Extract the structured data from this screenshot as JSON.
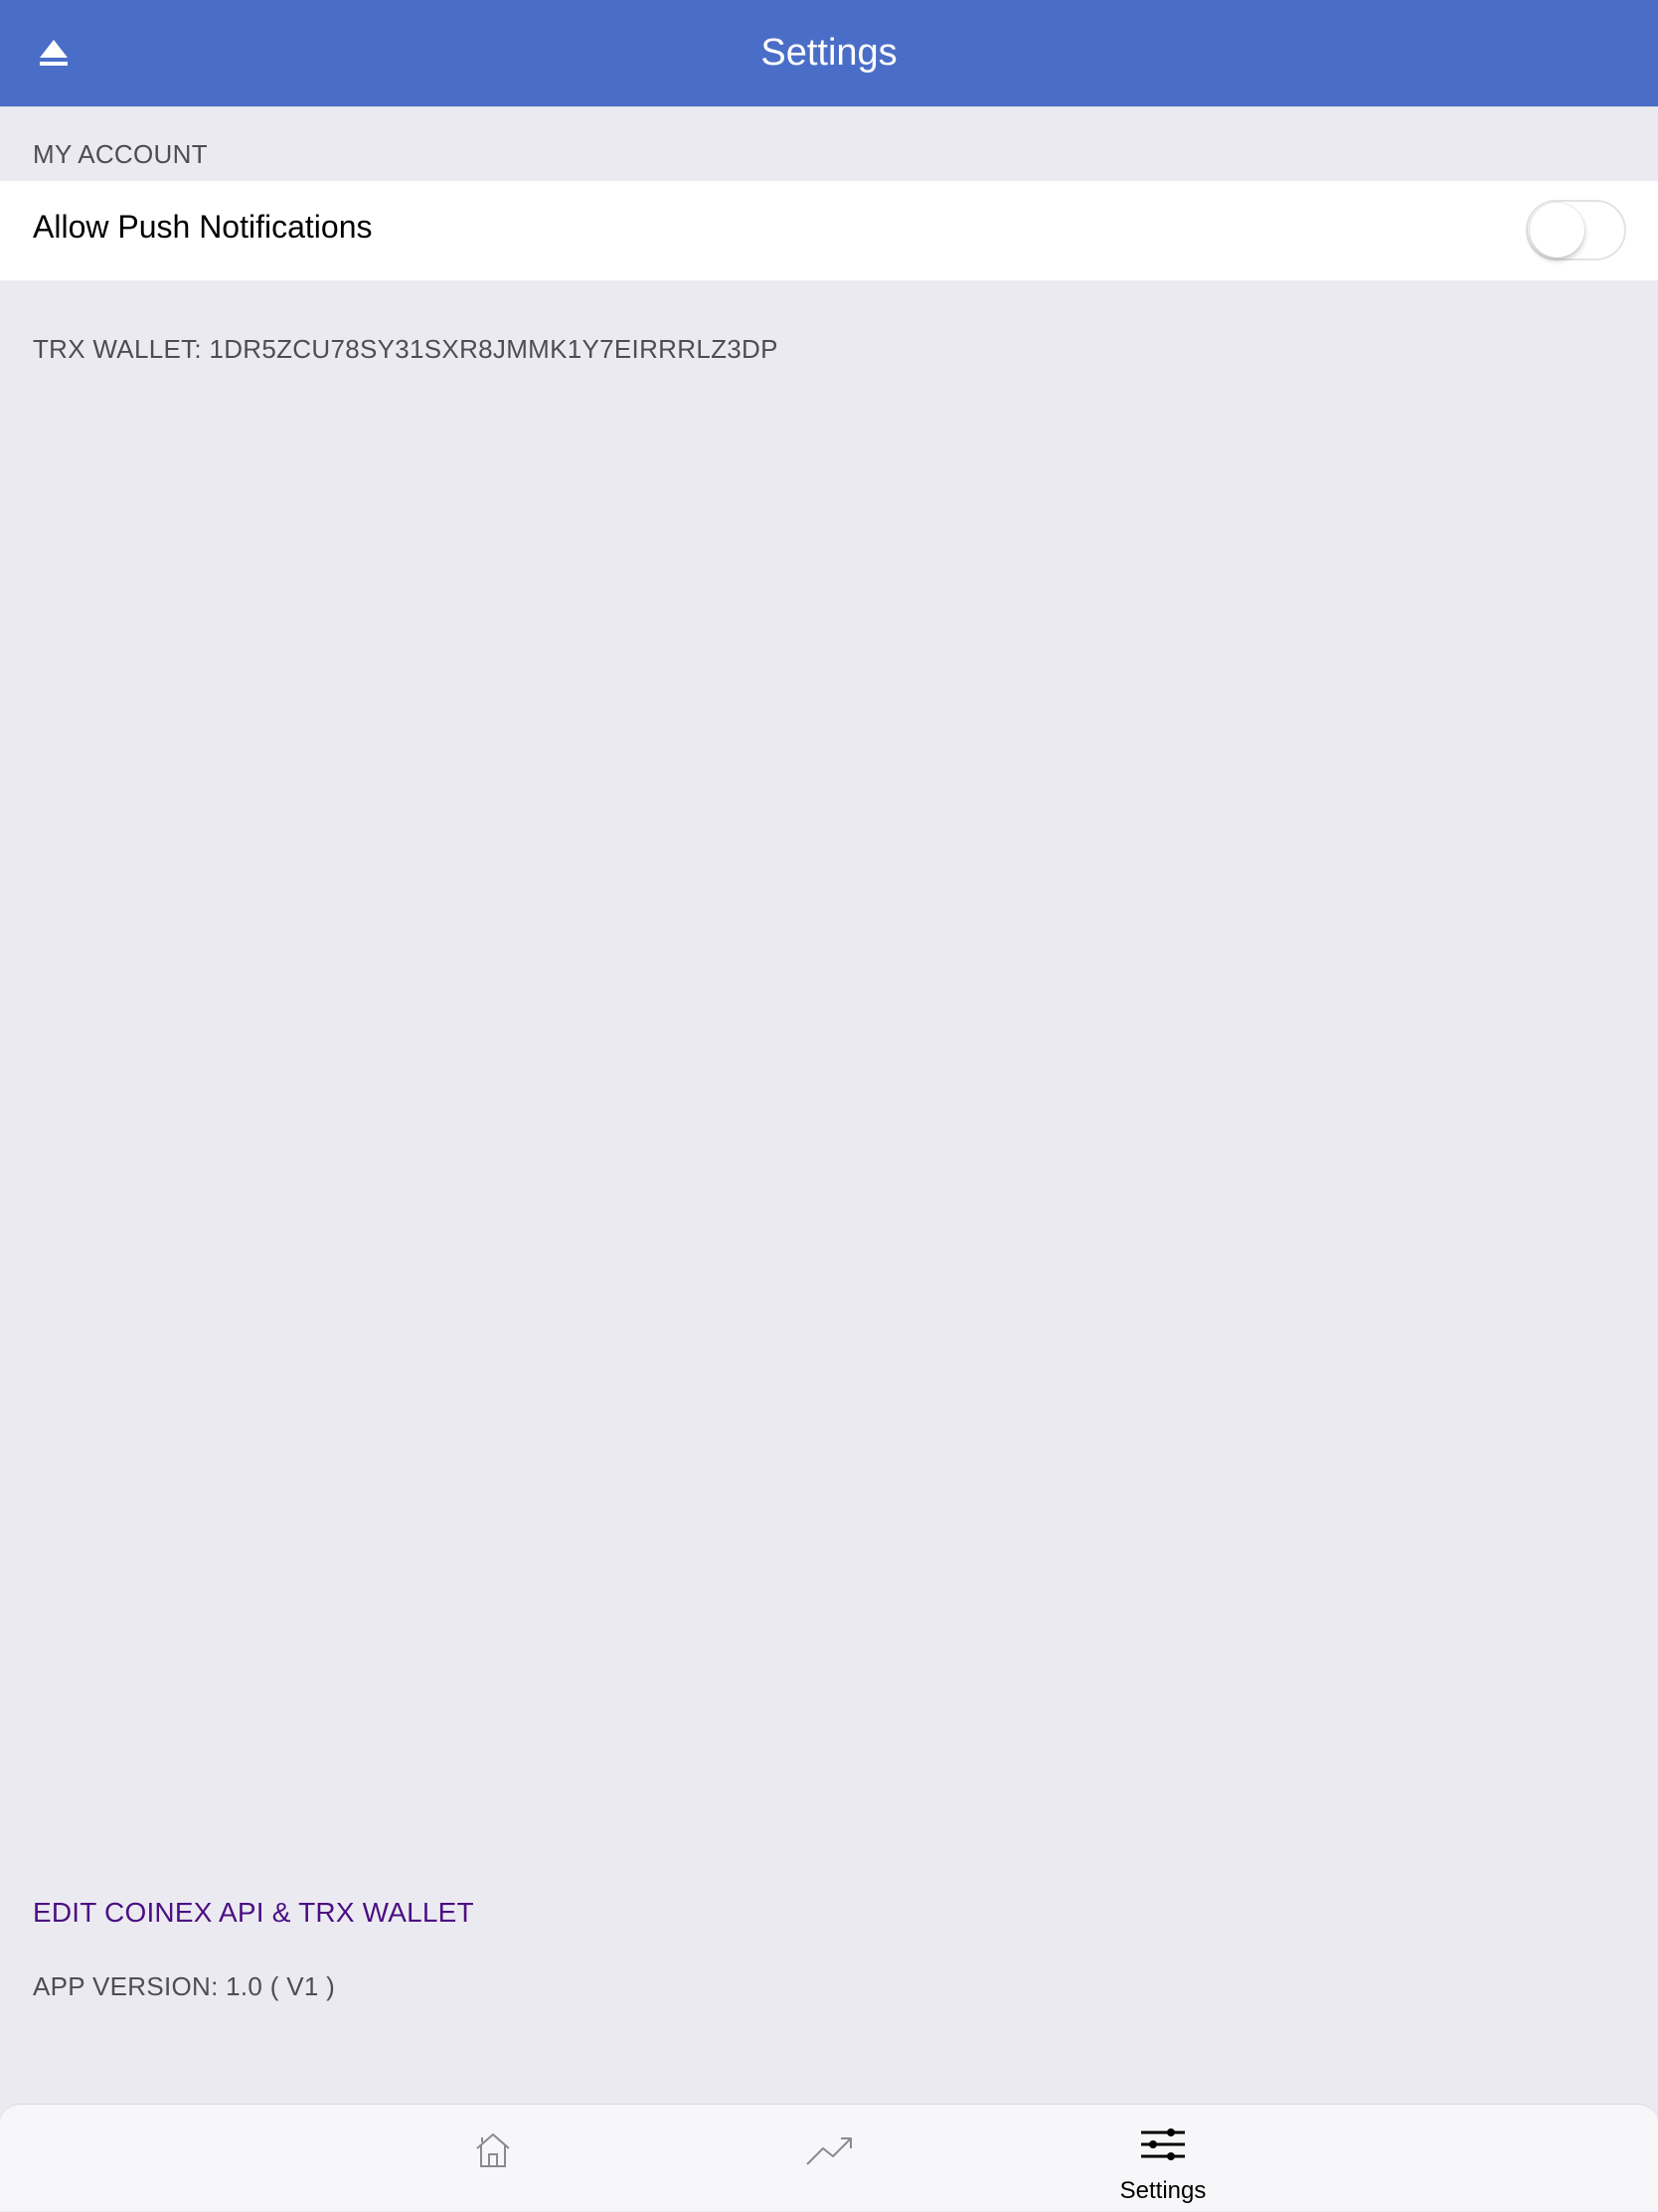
{
  "navbar": {
    "title": "Settings",
    "eject_icon": "eject-icon"
  },
  "account_section": {
    "header": "MY ACCOUNT",
    "push_notifications": {
      "label": "Allow Push Notifications",
      "enabled": false
    }
  },
  "wallet": {
    "text": "TRX WALLET: 1DR5ZCU78SY31SXR8JMMK1Y7EIRRRLZ3DP"
  },
  "actions": {
    "edit_label": "EDIT COINEX API & TRX WALLET"
  },
  "app_version": {
    "text": "APP VERSION: 1.0 ( V1 )"
  },
  "tabbar": {
    "tabs": [
      {
        "icon": "home-icon",
        "label": "",
        "selected": false
      },
      {
        "icon": "trending-up-icon",
        "label": "",
        "selected": false
      },
      {
        "icon": "sliders-icon",
        "label": "Settings",
        "selected": true
      }
    ]
  },
  "colors": {
    "navbar": "#4a6ec7",
    "background": "#ebeaf1",
    "link": "#4b0f82",
    "section_text": "#4d4d52"
  }
}
